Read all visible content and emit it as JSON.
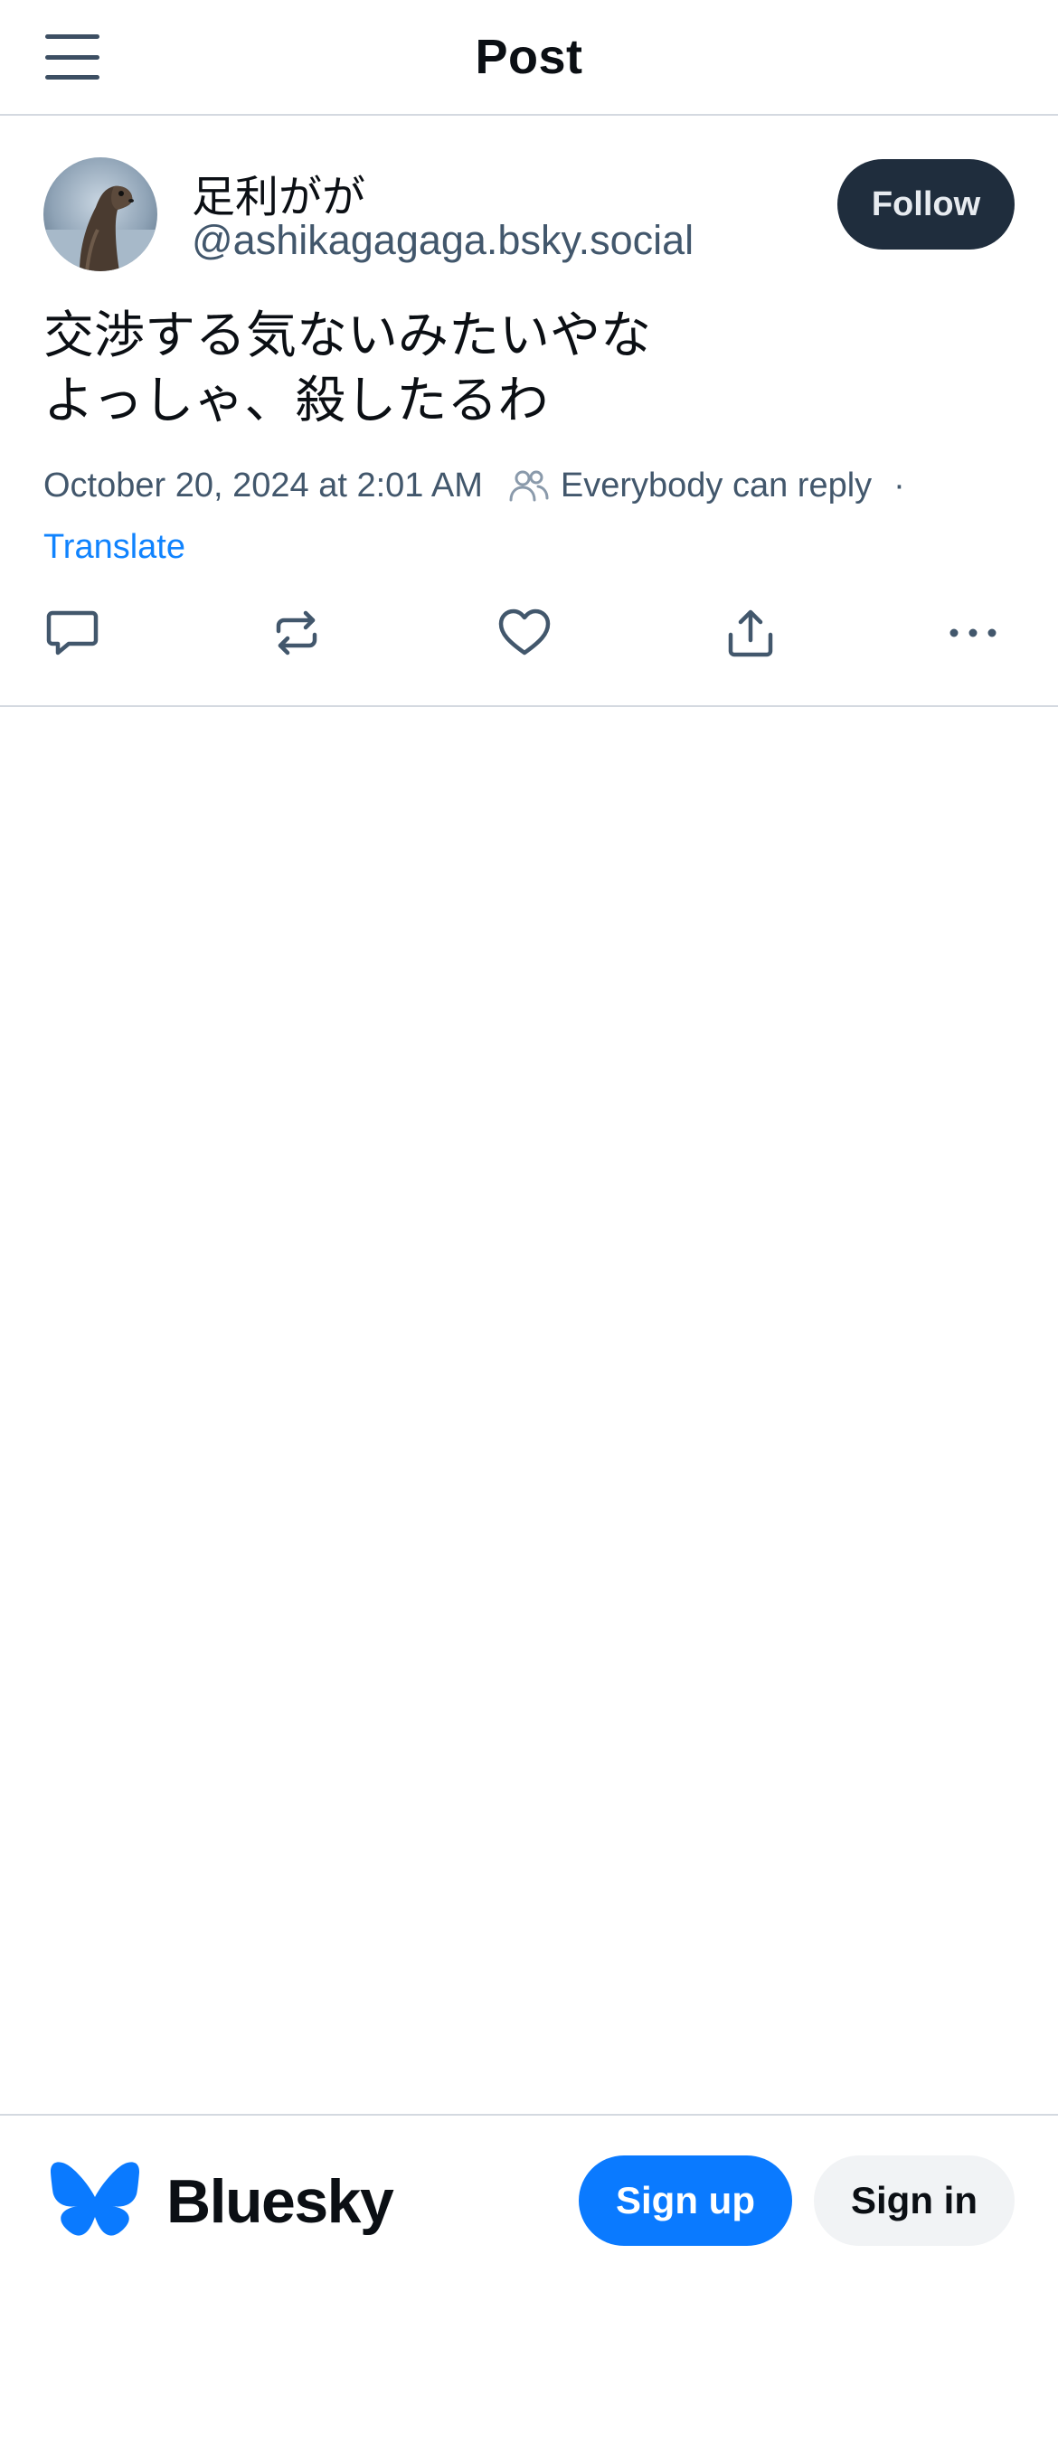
{
  "header": {
    "menu_icon": "hamburger-menu-icon",
    "title": "Post"
  },
  "post": {
    "author": {
      "display_name": "足利がが",
      "handle": "@ashikagagaga.bsky.social",
      "avatar": "avatar-sea-lion-photo"
    },
    "follow_label": "Follow",
    "text": "交渉する気ないみたいやな\nよっしゃ、殺したるわ",
    "timestamp": "October 20, 2024 at 2:01 AM",
    "reply_setting": "Everybody can reply",
    "separator": "·",
    "translate_label": "Translate",
    "actions": [
      {
        "name": "reply",
        "icon": "comment-icon"
      },
      {
        "name": "repost",
        "icon": "repost-icon"
      },
      {
        "name": "like",
        "icon": "heart-icon"
      },
      {
        "name": "share",
        "icon": "share-icon"
      },
      {
        "name": "more",
        "icon": "more-dots-icon"
      }
    ]
  },
  "footer": {
    "brand_name": "Bluesky",
    "signup_label": "Sign up",
    "signin_label": "Sign in"
  },
  "colors": {
    "accent": "#0a7aff",
    "link": "#1083fe",
    "follow_bg": "#1f2d3d",
    "muted_text": "#42576c",
    "divider": "#d4d9e0"
  }
}
